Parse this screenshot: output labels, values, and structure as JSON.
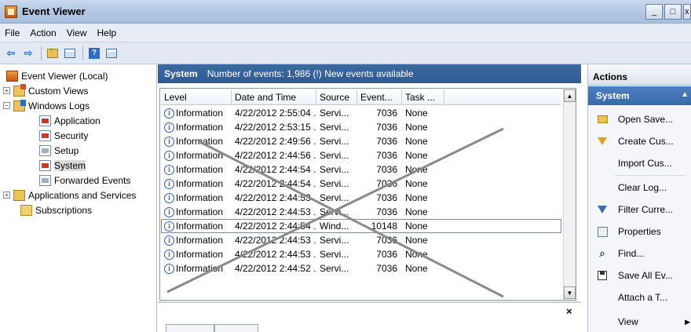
{
  "window": {
    "title": "Event Viewer"
  },
  "menu": [
    "File",
    "Action",
    "View",
    "Help"
  ],
  "tree": {
    "items": [
      {
        "label": "Event Viewer (Local)",
        "icon": "event-viewer-icon"
      },
      {
        "label": "Custom Views",
        "icon": "folder-icon",
        "expander": "+"
      },
      {
        "label": "Windows Logs",
        "icon": "folder-icon",
        "expander": "−"
      },
      {
        "label": "Application",
        "icon": "log-icon"
      },
      {
        "label": "Security",
        "icon": "log-icon"
      },
      {
        "label": "Setup",
        "icon": "log-icon"
      },
      {
        "label": "System",
        "icon": "log-icon"
      },
      {
        "label": "Forwarded Events",
        "icon": "log-icon"
      },
      {
        "label": "Applications and Services",
        "icon": "folder-icon",
        "expander": "+"
      },
      {
        "label": "Subscriptions",
        "icon": "subscriptions-icon"
      }
    ],
    "selected": "System"
  },
  "center": {
    "title": "System",
    "subtitle": "Number of events: 1,986 (!) New events available",
    "columns": [
      "Level",
      "Date and Time",
      "Source",
      "Event...",
      "Task ..."
    ],
    "rows": [
      {
        "level": "Information",
        "date": "4/22/2012 2:55:04 ...",
        "source": "Servi...",
        "event": "7036",
        "task": "None"
      },
      {
        "level": "Information",
        "date": "4/22/2012 2:53:15 ...",
        "source": "Servi...",
        "event": "7036",
        "task": "None"
      },
      {
        "level": "Information",
        "date": "4/22/2012 2:49:56 ...",
        "source": "Servi...",
        "event": "7036",
        "task": "None"
      },
      {
        "level": "Information",
        "date": "4/22/2012 2:44:56 ...",
        "source": "Servi...",
        "event": "7036",
        "task": "None"
      },
      {
        "level": "Information",
        "date": "4/22/2012 2:44:54 ...",
        "source": "Servi...",
        "event": "7036",
        "task": "None"
      },
      {
        "level": "Information",
        "date": "4/22/2012 2:44:54 ...",
        "source": "Servi...",
        "event": "7036",
        "task": "None"
      },
      {
        "level": "Information",
        "date": "4/22/2012 2:44:53 ...",
        "source": "Servi...",
        "event": "7036",
        "task": "None"
      },
      {
        "level": "Information",
        "date": "4/22/2012 2:44:53 ...",
        "source": "Servi...",
        "event": "7036",
        "task": "None"
      },
      {
        "level": "Information",
        "date": "4/22/2012 2:44:54 ...",
        "source": "Wind...",
        "event": "10148",
        "task": "None"
      },
      {
        "level": "Information",
        "date": "4/22/2012 2:44:53 ...",
        "source": "Servi...",
        "event": "7036",
        "task": "None"
      },
      {
        "level": "Information",
        "date": "4/22/2012 2:44:53 ...",
        "source": "Servi...",
        "event": "7036",
        "task": "None"
      },
      {
        "level": "Information",
        "date": "4/22/2012 2:44:52 ...",
        "source": "Servi...",
        "event": "7036",
        "task": "None"
      }
    ],
    "selected_row": 8,
    "close_glyph": "×"
  },
  "actions": {
    "header": "Actions",
    "section": "System",
    "items": [
      {
        "label": "Open Save...",
        "icon": "open-folder-icon"
      },
      {
        "label": "Create Cus...",
        "icon": "filter-icon"
      },
      {
        "label": "Import Cus...",
        "icon": ""
      },
      {
        "label": "Clear Log...",
        "icon": ""
      },
      {
        "label": "Filter Curre...",
        "icon": "filter-icon"
      },
      {
        "label": "Properties",
        "icon": "properties-icon"
      },
      {
        "label": "Find...",
        "icon": "find-icon"
      },
      {
        "label": "Save All Ev...",
        "icon": "save-icon"
      },
      {
        "label": "Attach a T...",
        "icon": ""
      },
      {
        "label": "View",
        "icon": ""
      }
    ]
  },
  "colors": {
    "header_blue": "#2f5a94",
    "section_blue": "#3a69a9",
    "cross_gray": "#8a8a8a"
  }
}
